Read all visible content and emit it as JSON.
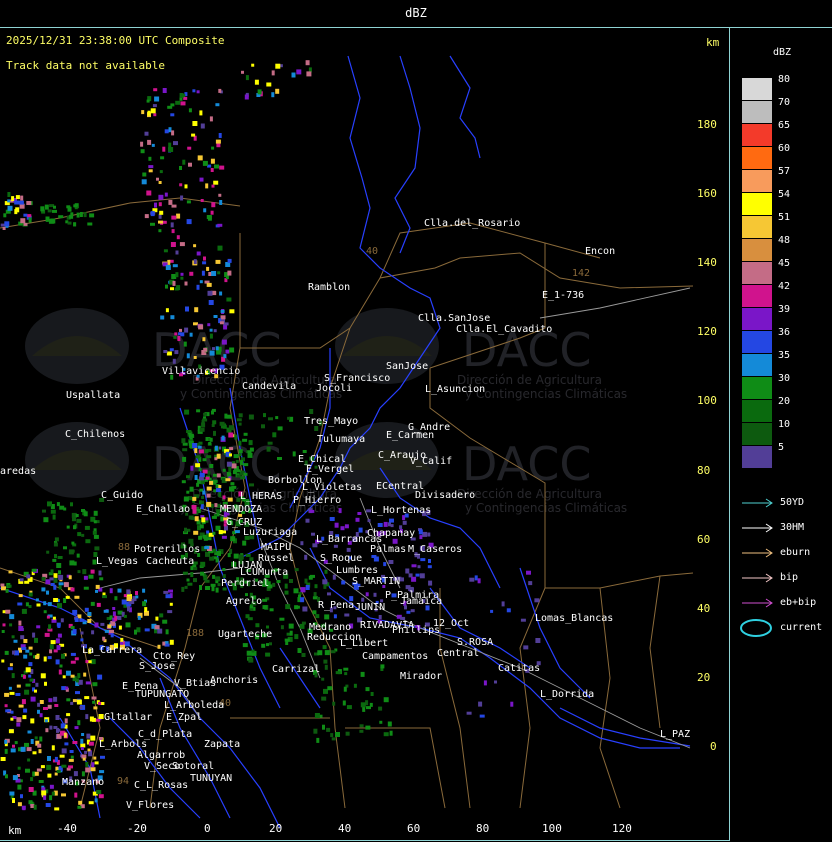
{
  "header": {
    "title": "dBZ"
  },
  "map": {
    "datetime_label": "2025/12/31 23:38:00 UTC Composite",
    "track_status": "Track data not available",
    "unit_top": "km",
    "unit_bottom": "km",
    "y_ticks": [
      "180",
      "160",
      "140",
      "120",
      "100",
      "80",
      "60",
      "40",
      "20",
      "0"
    ],
    "x_ticks": [
      "-40",
      "-20",
      "0",
      "20",
      "40",
      "60",
      "80",
      "100",
      "120"
    ],
    "route_numbers": [
      "40",
      "142",
      "188",
      "88",
      "40",
      "94"
    ],
    "watermark": {
      "brand": "DACC",
      "line1": "Dirección de Agricultura",
      "line2": "y Contingencias Climáticas"
    },
    "places": [
      {
        "id": "clla-del-rosario",
        "text": "Clla.del_Rosario"
      },
      {
        "id": "encon",
        "text": "Encon"
      },
      {
        "id": "e-1-736",
        "text": "E_1-736"
      },
      {
        "id": "ramblon",
        "text": "Ramblon"
      },
      {
        "id": "clla-sanjose",
        "text": "Clla.SanJose"
      },
      {
        "id": "clla-el-cavadito",
        "text": "Clla.El_Cavadito"
      },
      {
        "id": "villavicencio",
        "text": "Villavicencio"
      },
      {
        "id": "uspallata",
        "text": "Uspallata"
      },
      {
        "id": "candevila",
        "text": "Candevila"
      },
      {
        "id": "s-francisco",
        "text": "S_Francisco"
      },
      {
        "id": "jocoli",
        "text": "Jocoli"
      },
      {
        "id": "sanjose",
        "text": "SanJose"
      },
      {
        "id": "l-asuncion",
        "text": "L_Asuncion"
      },
      {
        "id": "c-chilenos",
        "text": "C_Chilenos"
      },
      {
        "id": "tres-mayo",
        "text": "Tres_Mayo"
      },
      {
        "id": "g-andre",
        "text": "G_Andre"
      },
      {
        "id": "tulumaya",
        "text": "Tulumaya"
      },
      {
        "id": "e-carmen",
        "text": "E_Carmen"
      },
      {
        "id": "paredas",
        "text": "aredas"
      },
      {
        "id": "e-chical",
        "text": "E_Chical"
      },
      {
        "id": "c-araujo",
        "text": "C_Araujo"
      },
      {
        "id": "v-calif",
        "text": "V_Calif"
      },
      {
        "id": "e-vergel",
        "text": "E_Vergel"
      },
      {
        "id": "borbollon",
        "text": "Borbollon"
      },
      {
        "id": "l-violetas",
        "text": "L_Violetas"
      },
      {
        "id": "ecentral",
        "text": "ECentral"
      },
      {
        "id": "c-guido",
        "text": "C_Guido"
      },
      {
        "id": "l-heras",
        "text": "L_HERAS"
      },
      {
        "id": "divisadero",
        "text": "Divisadero"
      },
      {
        "id": "p-hierro",
        "text": "P_Hierro"
      },
      {
        "id": "e-challao",
        "text": "E_Challao"
      },
      {
        "id": "mendoza",
        "text": "MENDOZA"
      },
      {
        "id": "l-hortenas",
        "text": "L_Hortenas"
      },
      {
        "id": "g-cruz",
        "text": "G_CRUZ"
      },
      {
        "id": "luzuriaga",
        "text": "Luzuriaga"
      },
      {
        "id": "chapanay",
        "text": "Chapanay"
      },
      {
        "id": "l-barrancas",
        "text": "L_Barrancas"
      },
      {
        "id": "maipu",
        "text": "MAIPU"
      },
      {
        "id": "potrerillos",
        "text": "Potrerillos"
      },
      {
        "id": "russel",
        "text": "Russel"
      },
      {
        "id": "palmas",
        "text": "Palmas"
      },
      {
        "id": "m-caseros",
        "text": "M_Caseros"
      },
      {
        "id": "l-vegas",
        "text": "L_Vegas"
      },
      {
        "id": "cacheuta",
        "text": "Cacheuta"
      },
      {
        "id": "s-roque",
        "text": "S_Roque"
      },
      {
        "id": "lujan",
        "text": "LUJAN"
      },
      {
        "id": "lumbres",
        "text": "Lumbres"
      },
      {
        "id": "cumunta",
        "text": "LCUMunta"
      },
      {
        "id": "s-martin",
        "text": "S_MARTIN"
      },
      {
        "id": "perdriel",
        "text": "Perdriel"
      },
      {
        "id": "palmira",
        "text": "P_Palmira"
      },
      {
        "id": "jamaica",
        "text": "Jamaica"
      },
      {
        "id": "agrelo",
        "text": "Agrelo"
      },
      {
        "id": "r-pena",
        "text": "R_Pena"
      },
      {
        "id": "junin",
        "text": "JUNIN"
      },
      {
        "id": "lomas-blancas",
        "text": "Lomas_Blancas"
      },
      {
        "id": "ugarteche",
        "text": "Ugarteche"
      },
      {
        "id": "medrano",
        "text": "Medrano"
      },
      {
        "id": "rivadavia",
        "text": "RIVADAVIA"
      },
      {
        "id": "phillips",
        "text": "Phillips"
      },
      {
        "id": "12-oct",
        "text": "12_Oct"
      },
      {
        "id": "reduccion",
        "text": "Reduccion"
      },
      {
        "id": "s-rosa",
        "text": "S.ROSA"
      },
      {
        "id": "la-carrera",
        "text": "La_Carrera"
      },
      {
        "id": "cto-rey",
        "text": "Cto_Rey"
      },
      {
        "id": "l-libert",
        "text": "L_Libert"
      },
      {
        "id": "s-jose",
        "text": "S_Jose"
      },
      {
        "id": "campamentos",
        "text": "Campamentos"
      },
      {
        "id": "central",
        "text": "Central"
      },
      {
        "id": "carrizal",
        "text": "Carrizal"
      },
      {
        "id": "catitas",
        "text": "Catitas"
      },
      {
        "id": "miralor",
        "text": "Mirador"
      },
      {
        "id": "anchoris",
        "text": "Anchoris"
      },
      {
        "id": "e-pena",
        "text": "E_Pena"
      },
      {
        "id": "v-btias",
        "text": "V_Btias"
      },
      {
        "id": "tupungato",
        "text": "TUPUNGATO"
      },
      {
        "id": "l-dorrida",
        "text": "L_Dorrida"
      },
      {
        "id": "l-arboleda",
        "text": "L_Arboleda"
      },
      {
        "id": "gltallar",
        "text": "Gltallar"
      },
      {
        "id": "e-zpal",
        "text": "E_Zpal"
      },
      {
        "id": "c-d-plata",
        "text": "C_d_Plata"
      },
      {
        "id": "l-paz",
        "text": "L_PAZ"
      },
      {
        "id": "l-arbols",
        "text": "L_Arbols"
      },
      {
        "id": "zapata",
        "text": "Zapata"
      },
      {
        "id": "algarrob",
        "text": "Algarrob"
      },
      {
        "id": "v-seco",
        "text": "V_Seco"
      },
      {
        "id": "sotoral",
        "text": "Sotoral"
      },
      {
        "id": "tunuyan",
        "text": "TUNUYAN"
      },
      {
        "id": "manzano",
        "text": "Manzano"
      },
      {
        "id": "c-l-rosas",
        "text": "C_L_Rosas"
      },
      {
        "id": "v-flores",
        "text": "V_Flores"
      }
    ]
  },
  "legend": {
    "title": "dBZ",
    "bins": [
      {
        "value": "80",
        "color": "#d8d8d8"
      },
      {
        "value": "70",
        "color": "#bdbdbd"
      },
      {
        "value": "65",
        "color": "#f33a2a"
      },
      {
        "value": "60",
        "color": "#ff6a11"
      },
      {
        "value": "57",
        "color": "#f89b5c"
      },
      {
        "value": "54",
        "color": "#ffff00"
      },
      {
        "value": "51",
        "color": "#f6c734"
      },
      {
        "value": "48",
        "color": "#d88f3e"
      },
      {
        "value": "45",
        "color": "#c46c86"
      },
      {
        "value": "42",
        "color": "#d0138d"
      },
      {
        "value": "39",
        "color": "#7a16c8"
      },
      {
        "value": "36",
        "color": "#2447e3"
      },
      {
        "value": "35",
        "color": "#148ad8"
      },
      {
        "value": "30",
        "color": "#0f8c16"
      },
      {
        "value": "20",
        "color": "#0a6a0e"
      },
      {
        "value": "10",
        "color": "#0d5a0f"
      },
      {
        "value": "5",
        "color": "#523e97"
      }
    ],
    "tracks": [
      {
        "label": "50YD",
        "color": "#4fd2d2"
      },
      {
        "label": "30HM",
        "color": "#ffffff"
      },
      {
        "label": "eburn",
        "color": "#f0c080"
      },
      {
        "label": "bip",
        "color": "#f4c8c8"
      },
      {
        "label": "eb+bip",
        "color": "#d050d0"
      },
      {
        "label": "current",
        "color": "#2fd0e0"
      }
    ]
  }
}
